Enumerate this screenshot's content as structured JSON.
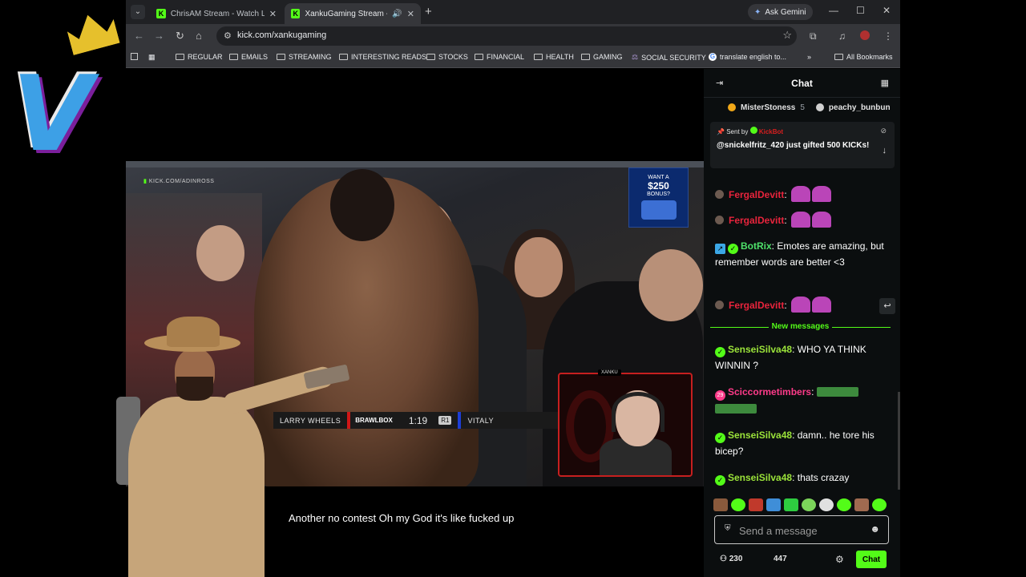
{
  "browser": {
    "tabs": [
      {
        "title": "ChrisAM Stream - Watch Live o",
        "active": false
      },
      {
        "title": "XankuGaming Stream - Wa",
        "active": true
      }
    ],
    "ask_gemini": "Ask Gemini",
    "url": "kick.com/xankugaming",
    "bookmarks": [
      "REGULAR",
      "EMAILS",
      "STREAMING",
      "INTERESTING READS",
      "STOCKS",
      "FINANCIAL",
      "HEALTH",
      "GAMING",
      "SOCIAL SECURITY",
      "translate english to...",
      "All Bookmarks"
    ]
  },
  "video": {
    "watermark": "KICK.COM/ADINROSS",
    "ad": {
      "line1": "WANT A",
      "amount": "$250",
      "line2": "BONUS?"
    },
    "scoreboard": {
      "fighter_left": "LARRY WHEELS",
      "promo": "BRAWLBOX",
      "clock": "1:19",
      "round": "R1",
      "fighter_right": "VITALY"
    },
    "webcam_label": "XANKU",
    "caption": "Another no contest Oh my God it's like fucked up"
  },
  "chat": {
    "title": "Chat",
    "gifters": [
      {
        "name": "MisterStoness",
        "count": "5"
      },
      {
        "name": "peachy_bunbun",
        "count": ""
      }
    ],
    "pinned": {
      "sent_by_label": "Sent by",
      "sender": "KickBot",
      "message": "@snickelfritz_420 just gifted 500 KICKs!"
    },
    "messages": [
      {
        "user": "FergalDevitt",
        "text": ""
      },
      {
        "user": "FergalDevitt",
        "text": ""
      },
      {
        "user": "BotRix",
        "text": "Emotes are amazing, but remember words are better <3"
      },
      {
        "user": "FergalDevitt",
        "text": ""
      },
      {
        "user": "SenseiSilva48",
        "text": "WHO YA THINK WINNIN ?"
      },
      {
        "user": "Sciccormetimbers",
        "text": ""
      },
      {
        "user": "SenseiSilva48",
        "text": "damn.. he tore his bicep?"
      },
      {
        "user": "SenseiSilva48",
        "text": "thats crazay"
      }
    ],
    "new_messages_label": "New messages",
    "input_placeholder": "Send a message",
    "viewers": "230",
    "followers": "447",
    "send_button": "Chat"
  },
  "colors": {
    "kick_green": "#53fc18",
    "fergal_red": "#e8243c",
    "botrix_green": "#4ee06a",
    "sensei_green": "#9be33a",
    "sciccor_pink": "#ff3b8a"
  }
}
